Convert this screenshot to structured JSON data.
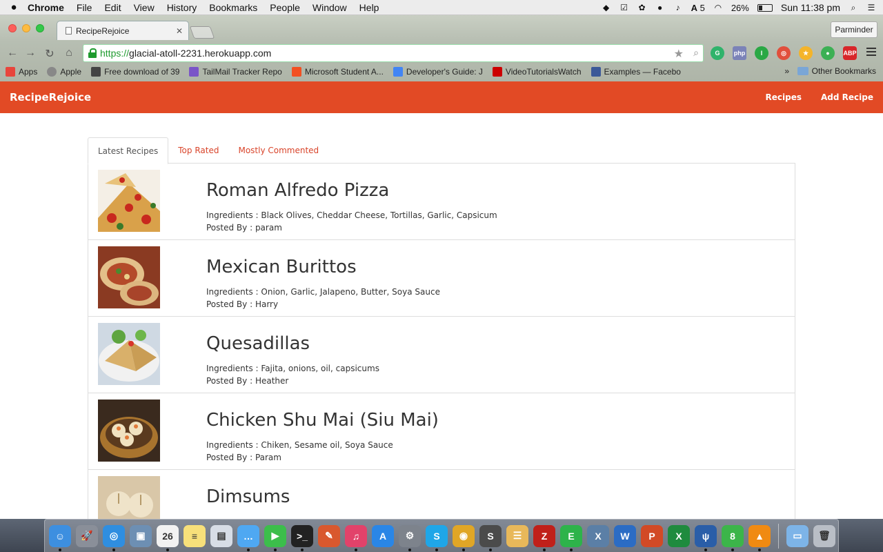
{
  "macos_menubar": {
    "app_name": "Chrome",
    "menus": [
      "File",
      "Edit",
      "View",
      "History",
      "Bookmarks",
      "People",
      "Window",
      "Help"
    ],
    "notification_badge": "5",
    "battery_percent": "26%",
    "battery_level": 0.26,
    "clock": "Sun 11:38 pm"
  },
  "browser": {
    "tab_title": "RecipeRejoice",
    "profile_name": "Parminder",
    "url_scheme": "https://",
    "url_rest": "glacial-atoll-2231.herokuapp.com",
    "bookmarks": [
      {
        "label": "Apps",
        "icon_color": "#e8453c"
      },
      {
        "label": "Apple",
        "icon_color": "#888888"
      },
      {
        "label": "Free download of 39",
        "icon_color": "#444444"
      },
      {
        "label": "TailMail Tracker Repo",
        "icon_color": "#7a55c8"
      },
      {
        "label": "Microsoft Student A...",
        "icon_color": "#f25022"
      },
      {
        "label": "Developer's Guide: J",
        "icon_color": "#4285f4"
      },
      {
        "label": "VideoTutorialsWatch",
        "icon_color": "#cc0000"
      },
      {
        "label": "Examples — Facebo",
        "icon_color": "#3b5998"
      }
    ],
    "other_bookmarks": "Other Bookmarks",
    "overflow_chevron": "»"
  },
  "site": {
    "brand": "RecipeRejoice",
    "nav": [
      "Recipes",
      "Add Recipe"
    ],
    "tabs": [
      "Latest Recipes",
      "Top Rated",
      "Mostly Commented"
    ],
    "active_tab": "Latest Recipes",
    "ingredients_label": "Ingredients : ",
    "posted_by_label": "Posted By : ",
    "recipes": [
      {
        "name": "Roman Alfredo Pizza",
        "ingredients": "Black Olives, Cheddar Cheese, Tortillas, Garlic, Capsicum",
        "posted_by": "param"
      },
      {
        "name": "Mexican Burittos",
        "ingredients": "Onion, Garlic, Jalapeno, Butter, Soya Sauce",
        "posted_by": "Harry"
      },
      {
        "name": "Quesadillas",
        "ingredients": "Fajita, onions, oil, capsicums",
        "posted_by": "Heather"
      },
      {
        "name": "Chicken Shu Mai (Siu Mai)",
        "ingredients": "Chiken, Sesame oil, Soya Sauce",
        "posted_by": "Param"
      },
      {
        "name": "Dimsums",
        "ingredients": "",
        "posted_by": ""
      }
    ]
  },
  "colors": {
    "navbar": "#e24a25",
    "tab_link": "#d9442a",
    "secure_green": "#1e9a2e"
  },
  "dock": {
    "apps": [
      {
        "name": "finder-icon",
        "color": "#3d8fe0",
        "glyph": "☺"
      },
      {
        "name": "launchpad-icon",
        "color": "#8a8f99",
        "glyph": "🚀"
      },
      {
        "name": "safari-icon",
        "color": "#2f8ee0",
        "glyph": "◎"
      },
      {
        "name": "preview-icon",
        "color": "#6d8fb3",
        "glyph": "▣"
      },
      {
        "name": "calendar-icon",
        "color": "#f2f2f2",
        "glyph": "26"
      },
      {
        "name": "notes-icon",
        "color": "#f7e07a",
        "glyph": "≡"
      },
      {
        "name": "photos-icon",
        "color": "#d7dde6",
        "glyph": "▤"
      },
      {
        "name": "messages-icon",
        "color": "#4fa8f2",
        "glyph": "…"
      },
      {
        "name": "facetime-icon",
        "color": "#3cbe4b",
        "glyph": "▶"
      },
      {
        "name": "terminal-icon",
        "color": "#222222",
        "glyph": ">_"
      },
      {
        "name": "pen-tool-icon",
        "color": "#d9582e",
        "glyph": "✎"
      },
      {
        "name": "itunes-icon",
        "color": "#e2426a",
        "glyph": "♫"
      },
      {
        "name": "app-store-icon",
        "color": "#2a86e6",
        "glyph": "A"
      },
      {
        "name": "system-preferences-icon",
        "color": "#7d838c",
        "glyph": "⚙"
      },
      {
        "name": "skype-icon",
        "color": "#1fa6e8",
        "glyph": "S"
      },
      {
        "name": "chrome-icon",
        "color": "#e0a626",
        "glyph": "◉"
      },
      {
        "name": "sublime-icon",
        "color": "#4b4b4b",
        "glyph": "S"
      },
      {
        "name": "stack-icon",
        "color": "#e8b85a",
        "glyph": "☰"
      },
      {
        "name": "filezilla-icon",
        "color": "#c0201a",
        "glyph": "Z"
      },
      {
        "name": "evernote-icon",
        "color": "#2db34a",
        "glyph": "E"
      },
      {
        "name": "xcode-icon",
        "color": "#5b7fa6",
        "glyph": "X"
      },
      {
        "name": "word-icon",
        "color": "#2b6cc4",
        "glyph": "W"
      },
      {
        "name": "powerpoint-icon",
        "color": "#d24a26",
        "glyph": "P"
      },
      {
        "name": "excel-icon",
        "color": "#1f8b3e",
        "glyph": "X"
      },
      {
        "name": "sourcetree-icon",
        "color": "#2a5ea8",
        "glyph": "ψ"
      },
      {
        "name": "evernote-helper-icon",
        "color": "#3cb54a",
        "glyph": "8"
      },
      {
        "name": "vlc-icon",
        "color": "#f08a12",
        "glyph": "▲"
      },
      {
        "name": "folder-icon",
        "color": "#7db4e8",
        "glyph": "▭"
      },
      {
        "name": "trash-icon",
        "color": "#b9bec6",
        "glyph": "🗑"
      }
    ]
  }
}
